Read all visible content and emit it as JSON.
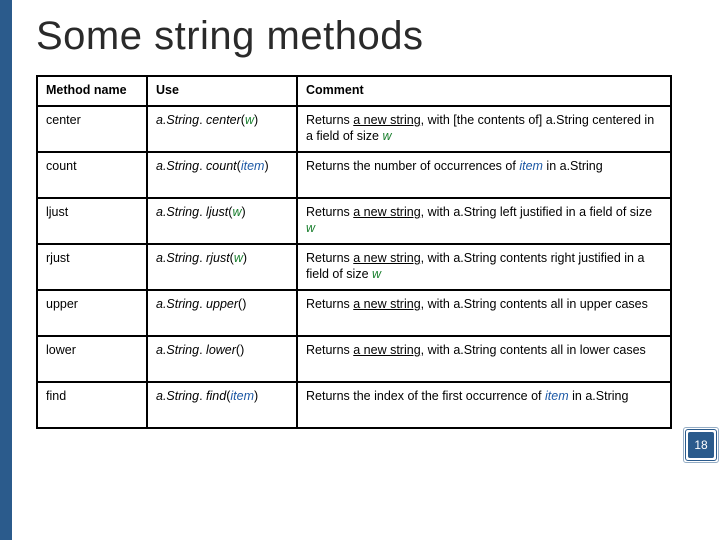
{
  "chart_data": {
    "type": "table",
    "title": "Some string methods",
    "columns": [
      "Method name",
      "Use",
      "Comment"
    ],
    "rows": [
      {
        "name": "center",
        "use": "a.String. center(w)",
        "comment": "Returns a new string, with [the contents of] a.String centered in a field of size w"
      },
      {
        "name": "count",
        "use": "a.String. count(item)",
        "comment": "Returns the number of occurrences of item in a.String"
      },
      {
        "name": "ljust",
        "use": "a.String. ljust(w)",
        "comment": "Returns a new string, with a.String left justified in a field of size w"
      },
      {
        "name": "rjust",
        "use": "a.String. rjust(w)",
        "comment": "Returns a new string, with a.String contents right justified in a field of size w"
      },
      {
        "name": "upper",
        "use": "a.String. upper()",
        "comment": "Returns a new string, with a.String contents all in upper cases"
      },
      {
        "name": "lower",
        "use": "a.String. lower()",
        "comment": "Returns a new string, with a.String contents all in lower cases"
      },
      {
        "name": "find",
        "use": "a.String. find(item)",
        "comment": "Returns the index of the first occurrence of item in a.String"
      }
    ]
  },
  "title": "Some string methods",
  "headers": {
    "c1": "Method name",
    "c2": "Use",
    "c3": "Comment"
  },
  "rows": {
    "r0_name": "center",
    "r1_name": "count",
    "r2_name": "ljust",
    "r3_name": "rjust",
    "r4_name": "upper",
    "r5_name": "lower",
    "r6_name": "find"
  },
  "tokens": {
    "obj": "a.String",
    "dot": ". ",
    "lp": "(",
    "rp": ")",
    "m_center": "center",
    "m_count": "count",
    "m_ljust": "ljust",
    "m_rjust": "rjust",
    "m_upper": "upper",
    "m_lower": "lower",
    "m_find": "find",
    "arg_w": "w",
    "arg_item": "item"
  },
  "phr": {
    "ret_new": "Returns ",
    "new_str": "a new string",
    "with_br": ", with [the contents of] ",
    "with": ", with ",
    "centered": " centered in a field of size ",
    "ret_num": "Returns the number of occurrences of ",
    "in": " in ",
    "ljust": " left justified in a field of size ",
    "rjust": " contents right justified in a field of size ",
    "upper": " contents all in upper cases",
    "lower": " contents all in lower cases",
    "ret_idx": "Returns the index of the first occurrence of "
  },
  "page_number": "18"
}
